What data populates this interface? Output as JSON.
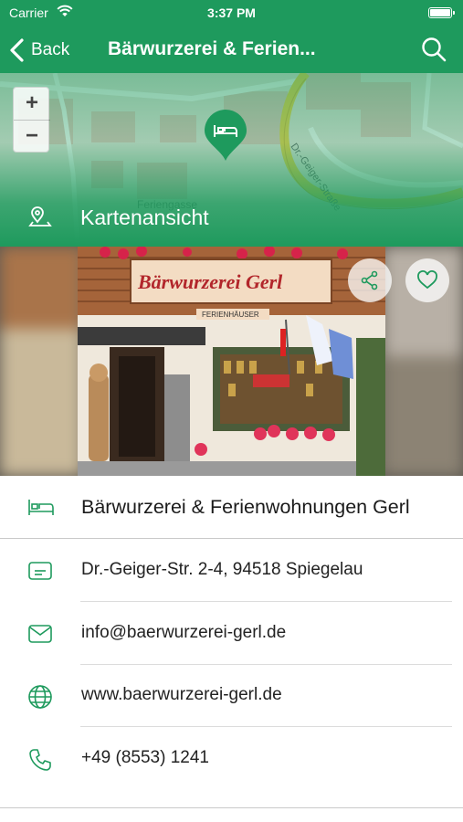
{
  "status_bar": {
    "carrier": "Carrier",
    "time": "3:37 PM"
  },
  "nav": {
    "back_label": "Back",
    "title": "Bärwurzerei & Ferien..."
  },
  "map": {
    "zoom_in": "+",
    "zoom_out": "−",
    "map_view_label": "Kartenansicht",
    "street_label": "Dr.-Geiger-Straße",
    "place_label": "Feriengasse"
  },
  "photo": {
    "sign_text": "Bärwurzerei Gerl",
    "sub_sign": "FERIENHÄUSER"
  },
  "details": {
    "name": "Bärwurzerei & Ferienwohnungen Gerl",
    "address": "Dr.-Geiger-Str. 2-4, 94518 Spiegelau",
    "email": "info@baerwurzerei-gerl.de",
    "website": "www.baerwurzerei-gerl.de",
    "phone": "+49 (8553) 1241"
  },
  "colors": {
    "accent": "#1e9a5d",
    "icon": "#1e9a5d"
  },
  "icons": {
    "back": "chevron-left-icon",
    "search": "search-icon",
    "map_pin": "bed-pin-icon",
    "map_view": "location-pin-icon",
    "share": "share-icon",
    "favorite": "heart-icon",
    "name": "bed-icon",
    "address": "address-card-icon",
    "email": "envelope-icon",
    "website": "globe-icon",
    "phone": "phone-icon"
  }
}
